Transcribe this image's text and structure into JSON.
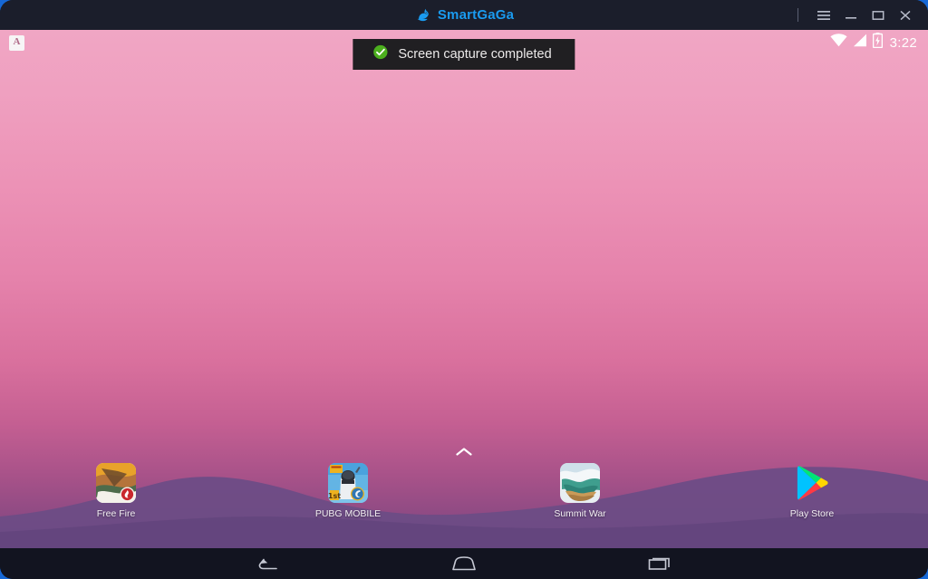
{
  "window": {
    "title": "SmartGaGa",
    "brand_color": "#1a9bf0",
    "titlebar_color": "#1b1e2b",
    "desktop_color": "#1668d6",
    "controls": [
      {
        "name": "menu",
        "label": "Menu",
        "icon": "hamburger-icon"
      },
      {
        "name": "minimize",
        "label": "Minimize",
        "icon": "minimize-icon"
      },
      {
        "name": "maximize",
        "label": "Maximize",
        "icon": "maximize-icon"
      },
      {
        "name": "close",
        "label": "Close",
        "icon": "close-icon"
      }
    ]
  },
  "status_bar": {
    "ime_indicator": "A",
    "clock": "3:22",
    "icons": [
      "wifi-icon",
      "cellular-signal-icon",
      "battery-charging-icon"
    ]
  },
  "toast": {
    "message": "Screen capture completed",
    "icon": "success-check-icon",
    "icon_color": "#4caf1e",
    "background": "#201f22"
  },
  "home": {
    "app_drawer_handle_icon": "chevron-up-icon",
    "wallpaper": {
      "gradient_top": "#f0a6c4",
      "gradient_bottom": "#7b4580",
      "mountain_color": "#6b4c86"
    }
  },
  "dock": {
    "items": [
      {
        "label": "Free Fire",
        "icon": "free-fire-app-icon"
      },
      {
        "label": "PUBG MOBILE",
        "icon": "pubg-mobile-app-icon"
      },
      {
        "label": "Summit War",
        "icon": "summit-war-app-icon"
      },
      {
        "label": "Play Store",
        "icon": "google-play-store-icon"
      }
    ]
  },
  "nav_bar": {
    "buttons": [
      {
        "label": "Back",
        "icon": "back-icon"
      },
      {
        "label": "Home",
        "icon": "home-icon"
      },
      {
        "label": "Recents",
        "icon": "recents-icon"
      }
    ]
  }
}
